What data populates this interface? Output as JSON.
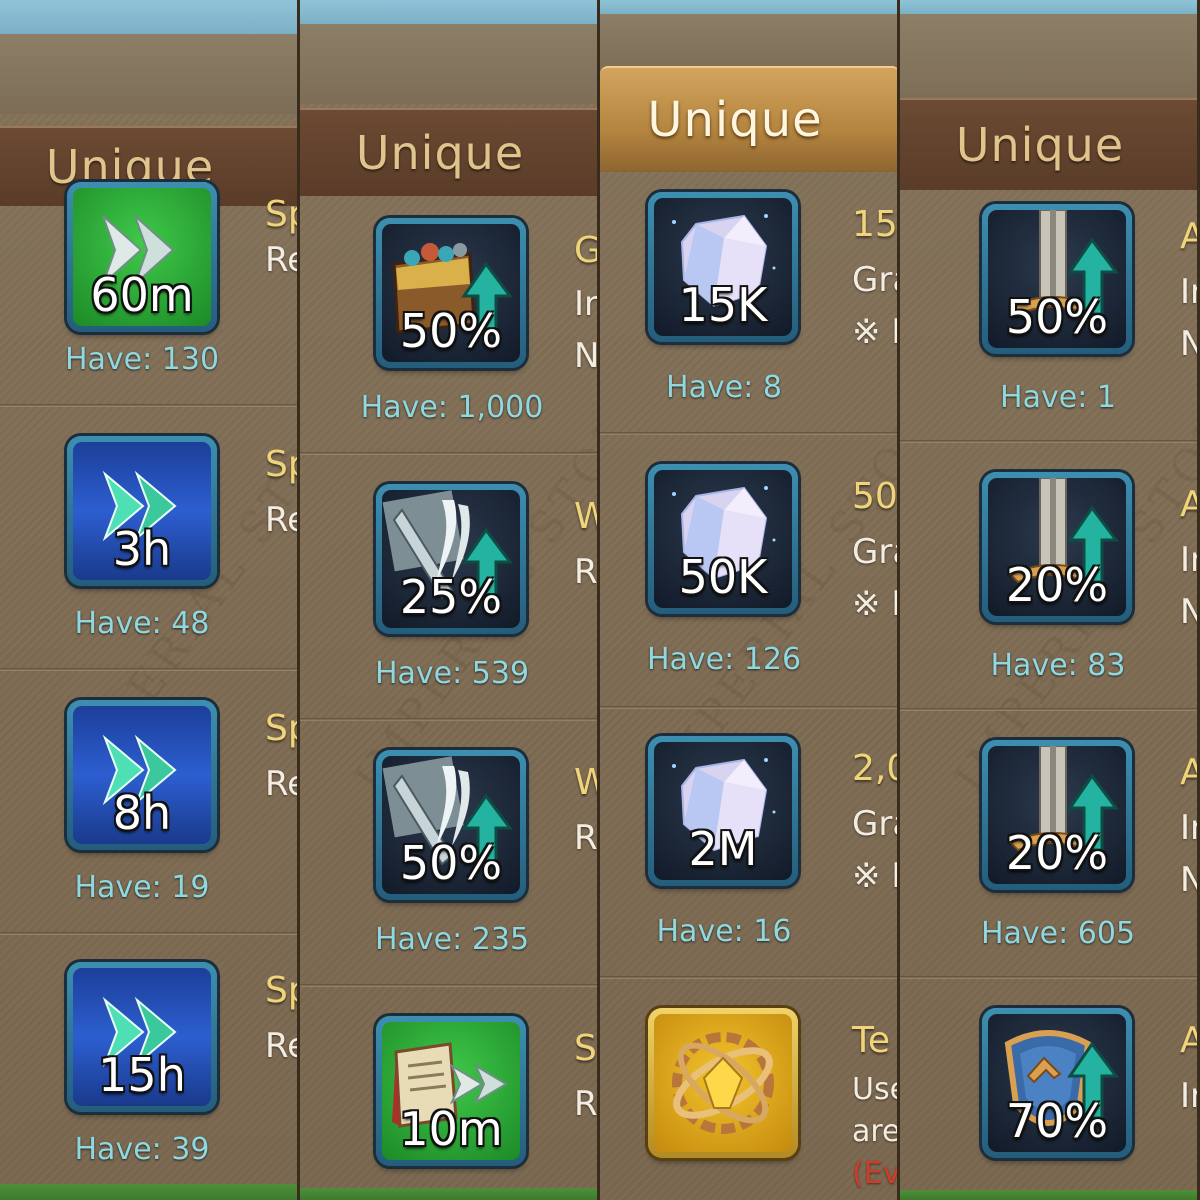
{
  "panels": [
    {
      "header": "Unique",
      "items": [
        {
          "value": "60m",
          "have": "Have: 130",
          "title": "Sp",
          "desc": "Re"
        },
        {
          "value": "3h",
          "have": "Have: 48",
          "title": "Sp",
          "desc": "Re"
        },
        {
          "value": "8h",
          "have": "Have: 19",
          "title": "Sp",
          "desc": "Re"
        },
        {
          "value": "15h",
          "have": "Have: 39",
          "title": "Sp",
          "desc": "Re"
        }
      ]
    },
    {
      "header": "Unique",
      "items": [
        {
          "value": "50%",
          "have": "Have: 1,000",
          "title": "G",
          "desc": "Ir",
          "desc2": "N"
        },
        {
          "value": "25%",
          "have": "Have: 539",
          "title": "W",
          "desc": "R"
        },
        {
          "value": "50%",
          "have": "Have: 235",
          "title": "W",
          "desc": "R"
        },
        {
          "value": "10m",
          "have": "",
          "title": "S",
          "desc": "R"
        }
      ]
    },
    {
      "header": "Unique",
      "items": [
        {
          "value": "15K",
          "have": "Have: 8",
          "title": "15",
          "desc": "Gra",
          "desc2": "※ I"
        },
        {
          "value": "50K",
          "have": "Have: 126",
          "title": "50",
          "desc": "Gra",
          "desc2": "※ I"
        },
        {
          "value": "2M",
          "have": "Have: 16",
          "title": "2,0",
          "desc": "Gra",
          "desc2": "※ I"
        },
        {
          "value": "",
          "have": "",
          "title": "Te",
          "desc": "Use",
          "desc2": "are",
          "desc3": "(Ev"
        }
      ]
    },
    {
      "header": "Unique",
      "items": [
        {
          "value": "50%",
          "have": "Have: 1",
          "title": "A",
          "desc": "Ir",
          "desc2": "N"
        },
        {
          "value": "20%",
          "have": "Have: 83",
          "title": "A",
          "desc": "Ir",
          "desc2": "N"
        },
        {
          "value": "20%",
          "have": "Have: 605",
          "title": "A",
          "desc": "Ir",
          "desc2": "N"
        },
        {
          "value": "70%",
          "have": "",
          "title": "A",
          "desc": "Ir"
        }
      ]
    }
  ],
  "colors": {
    "panel": "#7f6c54",
    "title": "#f0d47a",
    "have": "#8fd8e0",
    "header_active": "#d2a45e"
  }
}
